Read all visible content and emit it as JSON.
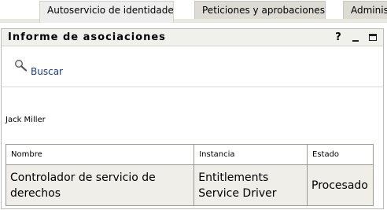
{
  "tabs": [
    {
      "label": "Autoservicio de identidades",
      "active": true
    },
    {
      "label": "Peticiones y aprobaciones",
      "active": false
    },
    {
      "label": "Administ",
      "active": false
    }
  ],
  "panel": {
    "title": "Informe de asociaciones",
    "help_label": "?"
  },
  "search": {
    "label": "Buscar",
    "icon": "magnifier-icon"
  },
  "user_name": "Jack Miller",
  "table": {
    "headers": [
      "Nombre",
      "Instancia",
      "Estado"
    ],
    "rows": [
      {
        "nombre": "Controlador de servicio de derechos",
        "instancia": "Entitlements Service Driver",
        "estado": "Procesado"
      }
    ]
  },
  "colors": {
    "tab_active": "#ededed",
    "tab_inactive": "#dcdcd4",
    "row_background": "#efeee9",
    "link": "#1c3a8a"
  }
}
